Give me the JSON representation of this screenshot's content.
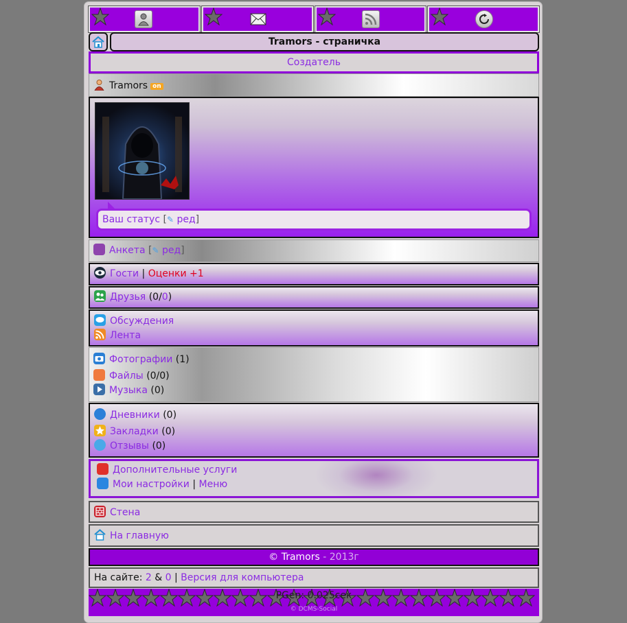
{
  "page": {
    "title": "Tramors - страничка"
  },
  "top_nav": [
    {
      "name": "profile",
      "icon": "user-icon"
    },
    {
      "name": "mail",
      "icon": "envelope-icon"
    },
    {
      "name": "rss",
      "icon": "rss-icon"
    },
    {
      "name": "refresh",
      "icon": "refresh-icon"
    }
  ],
  "creator_label": "Создатель",
  "user": {
    "nick": "Tramors",
    "online_badge": "on"
  },
  "status": {
    "label": "Ваш статус",
    "edit": "ред",
    "open": "[",
    "close": "]"
  },
  "anketa": {
    "label": "Анкета",
    "edit": "ред",
    "open": "[",
    "close": "]"
  },
  "guests": {
    "label": "Гости",
    "sep": "|",
    "ratings": "Оценки +1"
  },
  "friends": {
    "label": "Друзья",
    "count_a": "0",
    "count_b": "0"
  },
  "feeds": {
    "discussions": "Обсуждения",
    "lenta": "Лента"
  },
  "media": {
    "photos": "Фотографии",
    "photos_count": "(1)",
    "files": "Файлы",
    "files_count": "(0/0)",
    "music": "Музыка",
    "music_count": "(0)"
  },
  "blogs": {
    "diaries": "Дневники",
    "diaries_count": "(0)",
    "bookmarks": "Закладки",
    "bookmarks_count": "(0)",
    "reviews": "Отзывы",
    "reviews_count": "(0)"
  },
  "services": {
    "extra": "Дополнительные услуги",
    "settings": "Мои настройки",
    "sep": "|",
    "menu": "Меню"
  },
  "wall": "Стена",
  "home": "На главную",
  "footer": {
    "copy": "©",
    "nick": "Tramors",
    "year": "- 2013г"
  },
  "online": {
    "prefix": "На сайте:",
    "users": "2",
    "amp": "&",
    "guests": "0",
    "sep": "|",
    "pc_version": "Версия для компьютера"
  },
  "pgen": "PGen: 0.025сек",
  "credit": "© DCMS-Social",
  "colors": {
    "accent": "#9600dc",
    "link": "#8b2be2",
    "red": "#e0001f"
  }
}
